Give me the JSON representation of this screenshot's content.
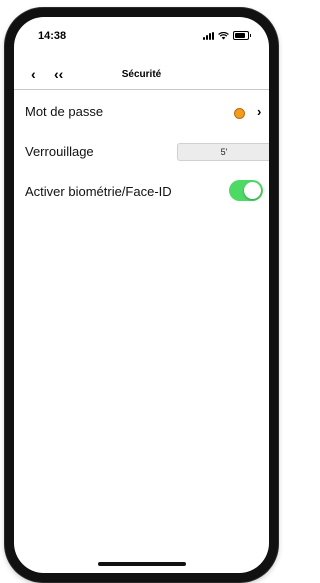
{
  "statusbar": {
    "time": "14:38",
    "icons": [
      "signal-icon",
      "wifi-icon",
      "battery-icon"
    ]
  },
  "navbar": {
    "back_glyph": "‹",
    "back_all_glyph": "‹‹",
    "title": "Sécurité"
  },
  "settings": {
    "password": {
      "label": "Mot de passe",
      "status_color": "#f39c1f",
      "chevron": "›"
    },
    "lock": {
      "label": "Verrouillage",
      "value": "5'"
    },
    "biometry": {
      "label": "Activer biométrie/Face-ID",
      "enabled": true,
      "toggle_color": "#4cd964"
    }
  }
}
